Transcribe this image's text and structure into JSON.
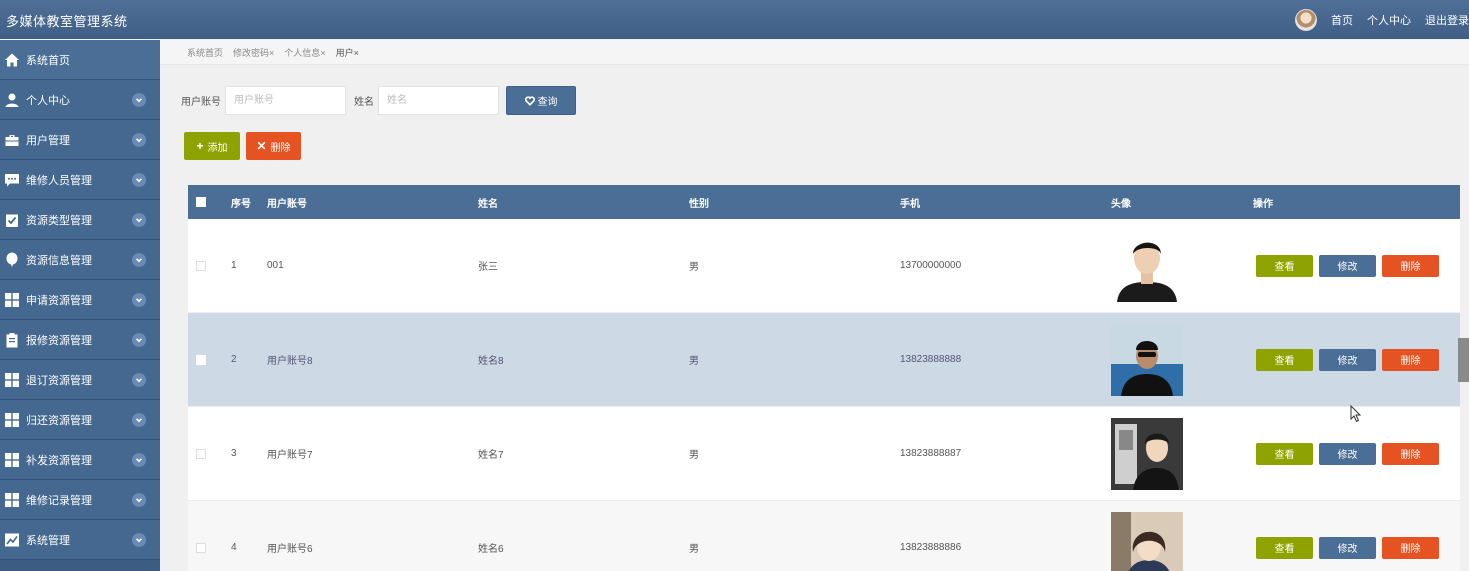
{
  "app": {
    "title": "多媒体教室管理系统"
  },
  "header": {
    "links": [
      "首页",
      "个人中心",
      "退出登录"
    ]
  },
  "sidebar": {
    "items": [
      {
        "label": "系统首页",
        "icon": "home-icon",
        "expandable": false
      },
      {
        "label": "个人中心",
        "icon": "user-icon",
        "expandable": true
      },
      {
        "label": "用户管理",
        "icon": "briefcase-icon",
        "expandable": true
      },
      {
        "label": "维修人员管理",
        "icon": "chat-icon",
        "expandable": true
      },
      {
        "label": "资源类型管理",
        "icon": "checklist-icon",
        "expandable": true
      },
      {
        "label": "资源信息管理",
        "icon": "balloon-icon",
        "expandable": true
      },
      {
        "label": "申请资源管理",
        "icon": "grid-icon",
        "expandable": true
      },
      {
        "label": "报修资源管理",
        "icon": "clipboard-icon",
        "expandable": true
      },
      {
        "label": "退订资源管理",
        "icon": "grid-icon",
        "expandable": true
      },
      {
        "label": "归还资源管理",
        "icon": "grid-icon",
        "expandable": true
      },
      {
        "label": "补发资源管理",
        "icon": "grid-icon",
        "expandable": true
      },
      {
        "label": "维修记录管理",
        "icon": "grid-icon",
        "expandable": true
      },
      {
        "label": "系统管理",
        "icon": "chart-icon",
        "expandable": true
      }
    ]
  },
  "tabs": [
    {
      "label": "系统首页",
      "closable": false
    },
    {
      "label": "修改密码",
      "closable": true
    },
    {
      "label": "个人信息",
      "closable": true
    },
    {
      "label": "用户",
      "closable": true,
      "active": true
    }
  ],
  "tab_close_glyph": "×",
  "search": {
    "account_label": "用户账号",
    "account_placeholder": "用户账号",
    "name_label": "姓名",
    "name_placeholder": "姓名",
    "query_label": "查询"
  },
  "actions": {
    "add_label": "添加",
    "add_glyph": "+",
    "delete_label": "删除",
    "delete_glyph": "✕"
  },
  "table": {
    "headers": {
      "index": "序号",
      "account": "用户账号",
      "name": "姓名",
      "gender": "性别",
      "phone": "手机",
      "avatar": "头像",
      "ops": "操作"
    },
    "op_labels": {
      "view": "查看",
      "edit": "修改",
      "delete": "删除"
    },
    "rows": [
      {
        "index": "1",
        "account": "001",
        "name": "张三",
        "gender": "男",
        "phone": "13700000000"
      },
      {
        "index": "2",
        "account": "用户账号8",
        "name": "姓名8",
        "gender": "男",
        "phone": "13823888888"
      },
      {
        "index": "3",
        "account": "用户账号7",
        "name": "姓名7",
        "gender": "男",
        "phone": "13823888887"
      },
      {
        "index": "4",
        "account": "用户账号6",
        "name": "姓名6",
        "gender": "男",
        "phone": "13823888886"
      }
    ]
  },
  "colors": {
    "primary": "#4a6e96",
    "add": "#8fa300",
    "danger": "#e55323",
    "row_highlight": "#cdd9e5"
  }
}
